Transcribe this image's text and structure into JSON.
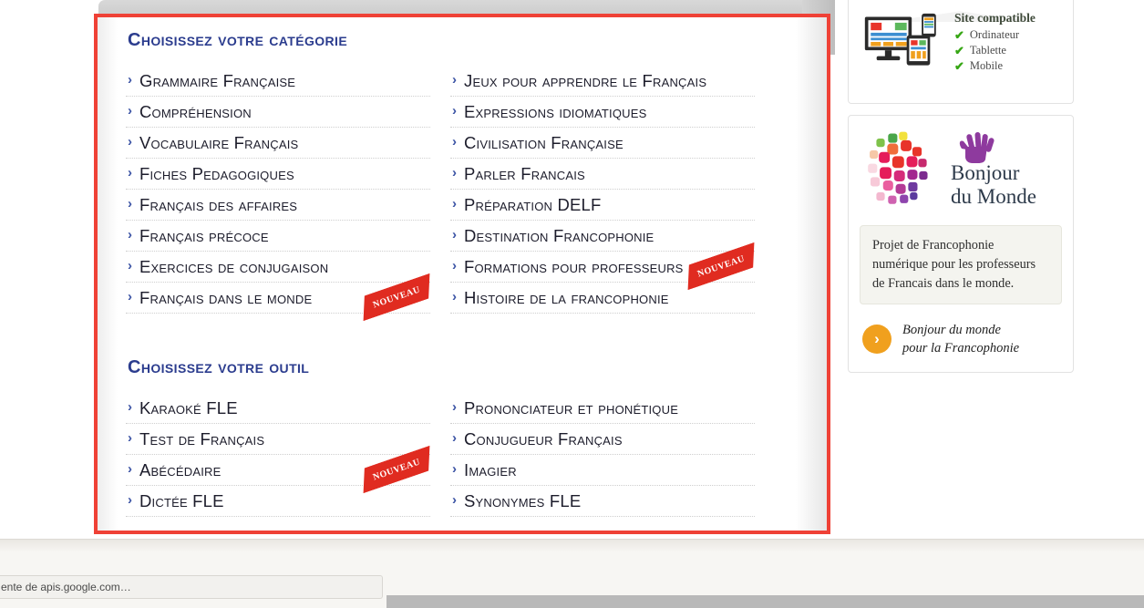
{
  "categories_section": {
    "title": "Choisissez votre catégorie",
    "left_items": [
      {
        "label": "Grammaire Française",
        "badge": null
      },
      {
        "label": "Compréhension",
        "badge": null
      },
      {
        "label": "Vocabulaire Français",
        "badge": null
      },
      {
        "label": "Fiches Pedagogiques",
        "badge": null
      },
      {
        "label": "Français des affaires",
        "badge": null
      },
      {
        "label": "Français précoce",
        "badge": null
      },
      {
        "label": "Exercices de conjugaison",
        "badge": null
      },
      {
        "label": "Français dans le monde",
        "badge": "NOUVEAU"
      }
    ],
    "right_items": [
      {
        "label": "Jeux pour apprendre le Français",
        "badge": null
      },
      {
        "label": "Expressions idiomatiques",
        "badge": null
      },
      {
        "label": "Civilisation Française",
        "badge": null
      },
      {
        "label": "Parler Francais",
        "badge": null
      },
      {
        "label": "Préparation DELF",
        "badge": null
      },
      {
        "label": "Destination Francophonie",
        "badge": null
      },
      {
        "label": "Formations pour professeurs",
        "badge": "NOUVEAU"
      },
      {
        "label": "Histoire de la francophonie",
        "badge": null
      }
    ]
  },
  "tools_section": {
    "title": "Choisissez votre outil",
    "left_items": [
      {
        "label": "Karaoké FLE",
        "badge": null
      },
      {
        "label": "Test de Français",
        "badge": null
      },
      {
        "label": "Abécédaire",
        "badge": "NOUVEAU"
      },
      {
        "label": "Dictée FLE",
        "badge": null
      }
    ],
    "right_items": [
      {
        "label": "Prononciateur et phonétique",
        "badge": null
      },
      {
        "label": "Conjugueur Français",
        "badge": null
      },
      {
        "label": "Imagier",
        "badge": null
      },
      {
        "label": "Synonymes FLE",
        "badge": null
      }
    ]
  },
  "sidebar": {
    "compatibility": {
      "title": "Site compatible",
      "items": [
        "Ordinateur",
        "Tablette",
        "Mobile"
      ],
      "check_glyph": "✔"
    },
    "bonjour_du_monde": {
      "name_line1": "Bonjour",
      "name_line2": "du Monde",
      "description": "Projet de Francophonie numérique pour les professeurs de Francais dans le monde.",
      "link_line1": "Bonjour du monde",
      "link_line2": "pour la Francophonie",
      "link_arrow": "›"
    }
  },
  "browser": {
    "status_text": "ente de apis.google.com…"
  },
  "icons": {
    "chevron": "›"
  },
  "colors": {
    "heading_blue": "#2b3c8e",
    "chevron_blue": "#3a52a4",
    "ribbon_red": "#e02b20",
    "selection_red": "#ef4136",
    "check_green": "#36a614",
    "orange": "#f0a01e"
  }
}
